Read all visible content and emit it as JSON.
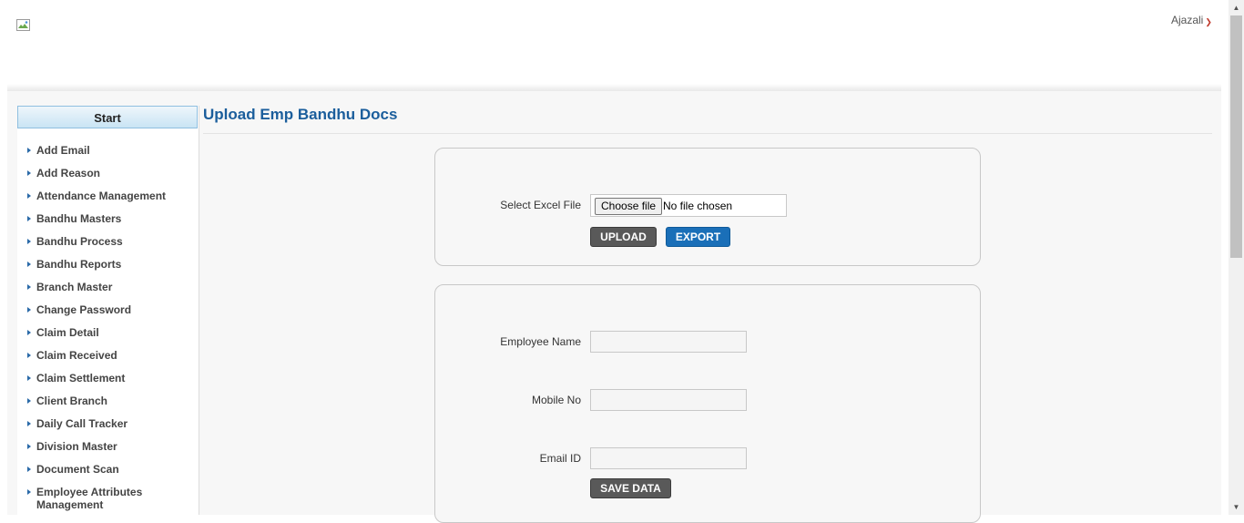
{
  "header": {
    "user_name": "Ajazali"
  },
  "sidebar": {
    "title": "Start",
    "items": [
      {
        "label": "Add Email"
      },
      {
        "label": "Add Reason"
      },
      {
        "label": "Attendance Management"
      },
      {
        "label": "Bandhu Masters"
      },
      {
        "label": "Bandhu Process"
      },
      {
        "label": "Bandhu Reports"
      },
      {
        "label": "Branch Master"
      },
      {
        "label": "Change Password"
      },
      {
        "label": "Claim Detail"
      },
      {
        "label": "Claim Received"
      },
      {
        "label": "Claim Settlement"
      },
      {
        "label": "Client Branch"
      },
      {
        "label": "Daily Call Tracker"
      },
      {
        "label": "Division Master"
      },
      {
        "label": "Document Scan"
      },
      {
        "label": "Employee Attributes Management"
      }
    ]
  },
  "main": {
    "title": "Upload Emp Bandhu Docs",
    "upload": {
      "file_label": "Select Excel File",
      "choose_label": "Choose file",
      "file_status": "No file chosen",
      "upload_button": "UPLOAD",
      "export_button": "EXPORT"
    },
    "form": {
      "employee_name_label": "Employee Name",
      "employee_name_value": "",
      "mobile_label": "Mobile No",
      "mobile_value": "",
      "email_label": "Email ID",
      "email_value": "",
      "save_button": "SAVE DATA"
    }
  },
  "colors": {
    "title_blue": "#1b5e9c",
    "export_blue": "#1a6fb8",
    "dark_button": "#595959"
  },
  "icons": {
    "logo": "broken-image-icon",
    "user_menu": "chevron-down-icon",
    "menu_item": "triangle-right-icon"
  }
}
